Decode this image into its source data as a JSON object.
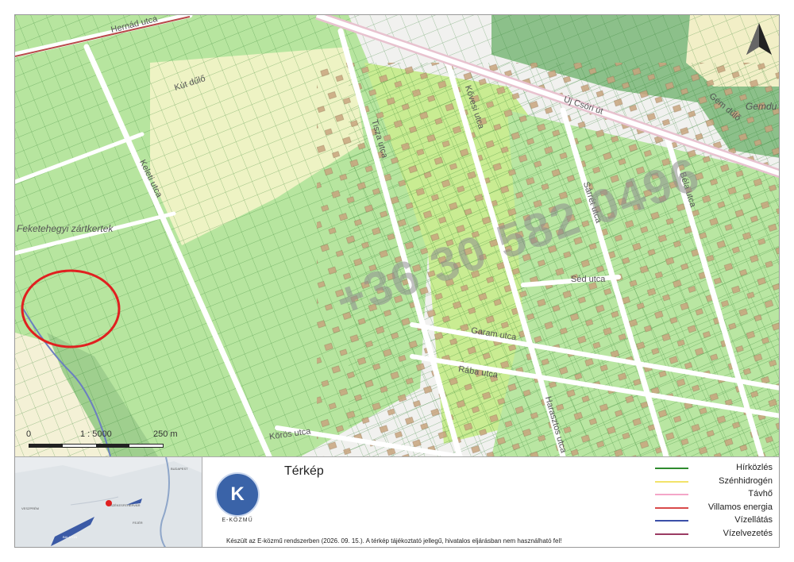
{
  "map": {
    "places": {
      "area": "Feketehegyi zártkertek",
      "district": "Gemdu"
    },
    "streets": {
      "hernad": "Hernád utca",
      "kut": "Kút dűlő",
      "keleti": "Keleti utca",
      "tiszai": "Tisza utca",
      "ujcsori": "Új Csóri út",
      "gemdulo": "Gém dűlő",
      "kovesi": "Kővesi utca",
      "sarret": "Sárrét utca",
      "seo": "Séd utca",
      "garam": "Garam utca",
      "raba": "Rába utca",
      "koros": "Körös utca",
      "haraszt": "Harasztos utca",
      "belo": "Béla utca"
    },
    "watermark": "+36 30 582 0496",
    "north_icon": "north-arrow-icon",
    "scale": {
      "zero": "0",
      "ratio": "1 : 5000",
      "distance": "250 m"
    }
  },
  "minimap": {
    "labels": [
      "BUDAPEST",
      "VESZPRÉM",
      "FEJÉR",
      "SZÉKESFEHÉRVÁR",
      "BALATON"
    ]
  },
  "footer": {
    "title": "Térkép",
    "brand": "E-KÖZMŰ",
    "logo_letter": "K",
    "note": "Készült az E-közmű rendszerben (2026. 09. 15.). A térkép tájékoztató jellegű, hivatalos eljárásban nem használható fel!"
  },
  "legend": [
    {
      "label": "Hírközlés",
      "color": "#2e8b2e"
    },
    {
      "label": "Szénhidrogén",
      "color": "#f2e36a"
    },
    {
      "label": "Távhő",
      "color": "#f4a6c8"
    },
    {
      "label": "Villamos energia",
      "color": "#d94a4a"
    },
    {
      "label": "Vízellátás",
      "color": "#3b4fa8"
    },
    {
      "label": "Vízelvezetés",
      "color": "#9b3b63"
    }
  ],
  "colors": {
    "green": "#a8df8c",
    "light_green": "#c8ecb6",
    "forest": "#8cc08a",
    "building": "#c8a47e",
    "yellow": "#f5f3c0",
    "highlight": "#e02020"
  }
}
